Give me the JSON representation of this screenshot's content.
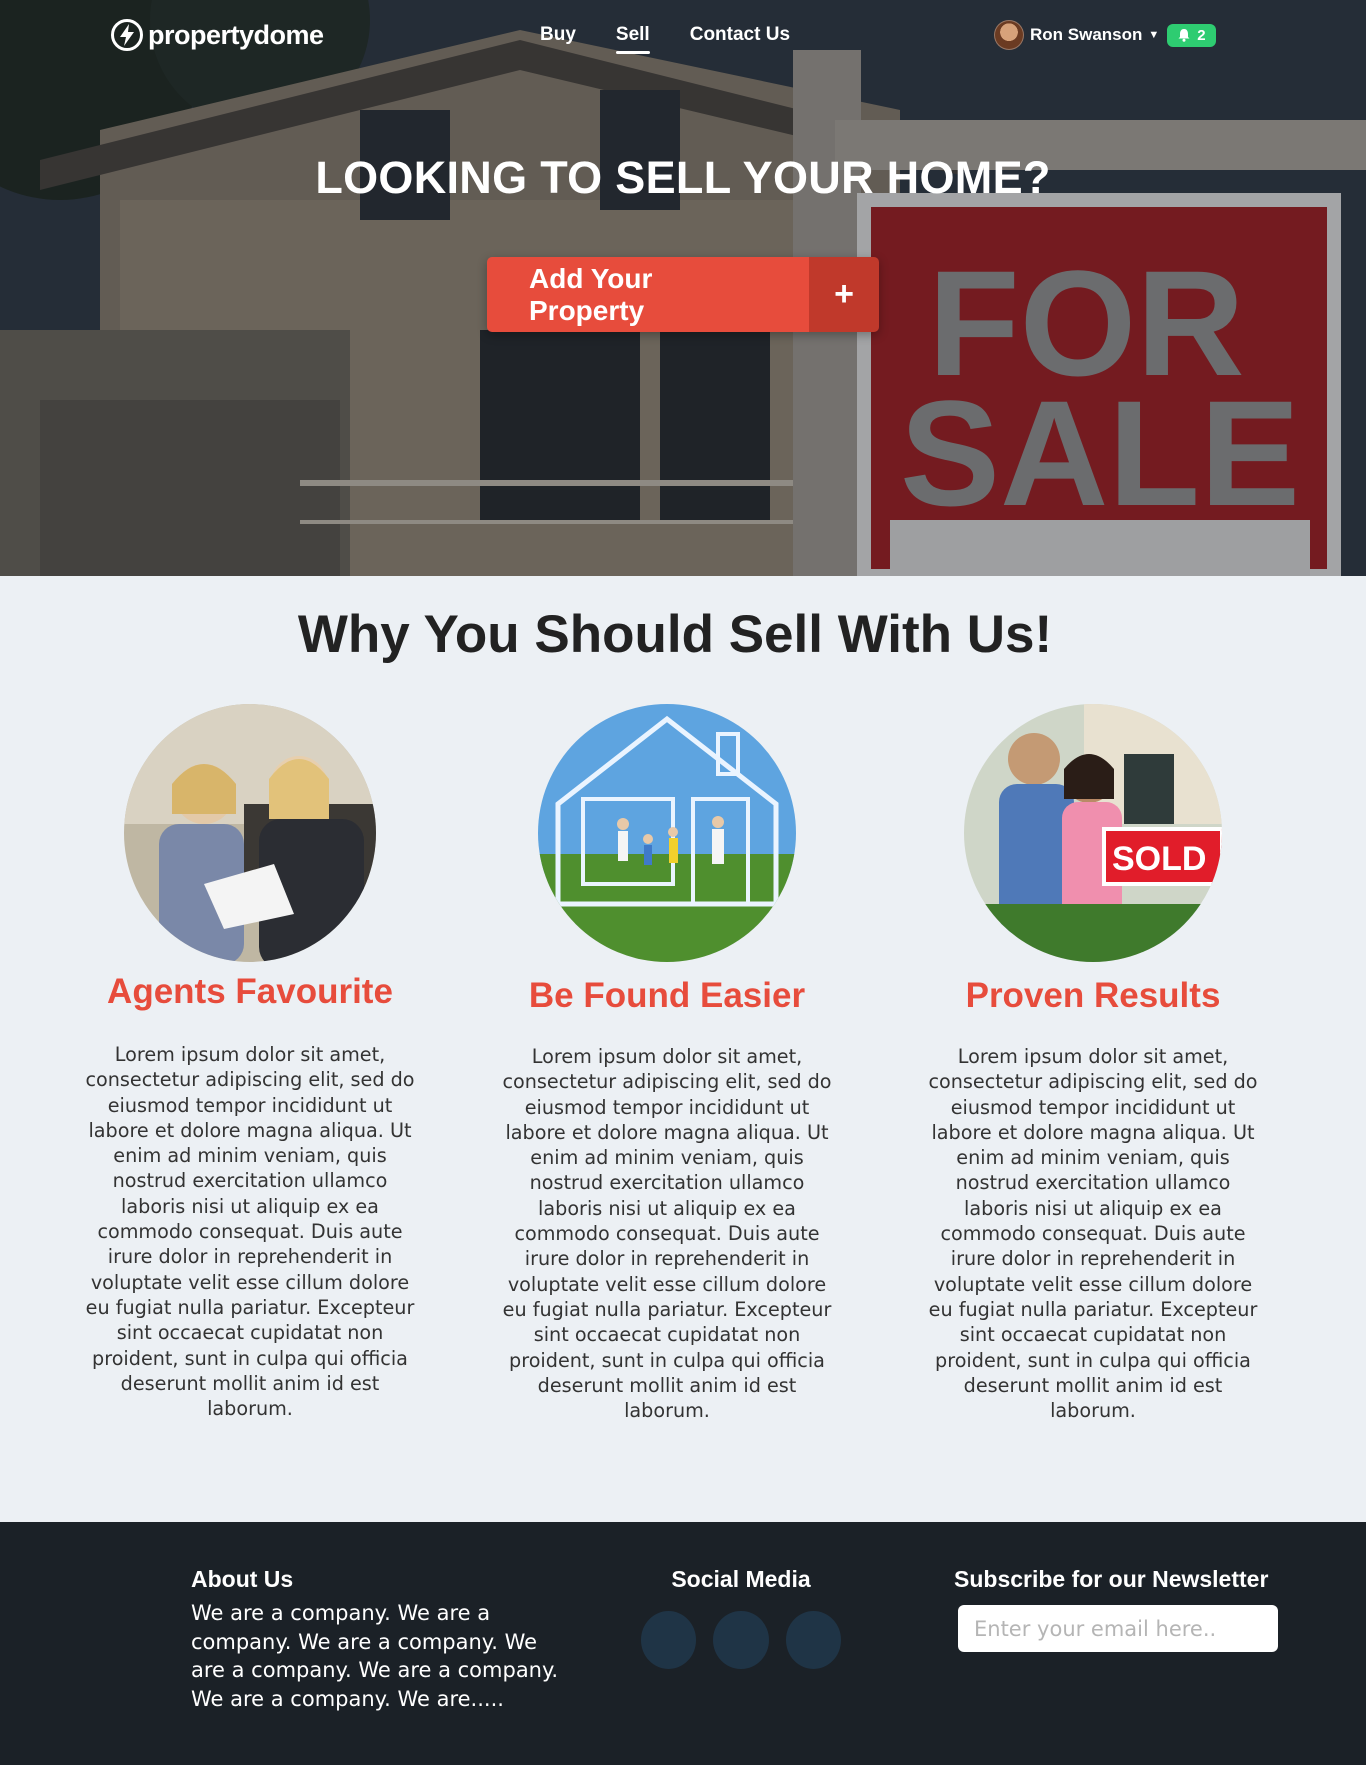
{
  "brand": {
    "name": "propertydome"
  },
  "nav": {
    "items": [
      {
        "label": "Buy"
      },
      {
        "label": "Sell",
        "active": true
      },
      {
        "label": "Contact Us"
      }
    ]
  },
  "user": {
    "name": "Ron Swanson",
    "notifications": "2"
  },
  "hero": {
    "title": "LOOKING TO SELL YOUR HOME?",
    "cta_label": "Add Your Property",
    "cta_icon": "+",
    "sign_line1": "FOR",
    "sign_line2": "SALE"
  },
  "why": {
    "title": "Why You Should Sell With Us!",
    "features": [
      {
        "title": "Agents Favourite",
        "text": "Lorem ipsum dolor sit amet, consectetur adipiscing elit, sed do eiusmod tempor incididunt ut labore et dolore magna aliqua. Ut enim ad minim veniam, quis nostrud exercitation ullamco laboris nisi ut aliquip ex ea commodo consequat. Duis aute irure dolor in reprehenderit in voluptate velit esse cillum dolore eu fugiat nulla pariatur. Excepteur sint occaecat cupidatat non proident, sunt in culpa qui officia deserunt mollit anim id est laborum."
      },
      {
        "title": "Be Found Easier",
        "text": "Lorem ipsum dolor sit amet, consectetur adipiscing elit, sed do eiusmod tempor incididunt ut labore et dolore magna aliqua. Ut enim ad minim veniam, quis nostrud exercitation ullamco laboris nisi ut aliquip ex ea commodo consequat. Duis aute irure dolor in reprehenderit in voluptate velit esse cillum dolore eu fugiat nulla pariatur. Excepteur sint occaecat cupidatat non proident, sunt in culpa qui officia deserunt mollit anim id est laborum."
      },
      {
        "title": "Proven Results",
        "text": "Lorem ipsum dolor sit amet, consectetur adipiscing elit, sed do eiusmod tempor incididunt ut labore et dolore magna aliqua. Ut enim ad minim veniam, quis nostrud exercitation ullamco laboris nisi ut aliquip ex ea commodo consequat. Duis aute irure dolor in reprehenderit in voluptate velit esse cillum dolore eu fugiat nulla pariatur. Excepteur sint occaecat cupidatat non proident, sunt in culpa qui officia deserunt mollit anim id est laborum.",
        "badge": "SOLD"
      }
    ]
  },
  "footer": {
    "about_title": "About Us",
    "about_text": "We are a company. We are a company. We are a company. We are a company. We are a company. We are a company. We are.....",
    "social_title": "Social Media",
    "newsletter_title": "Subscribe for our Newsletter",
    "email_placeholder": "Enter your email here.."
  },
  "colors": {
    "accent": "#e74c3c",
    "accent_dark": "#c0392b",
    "notif": "#2ecc71",
    "footer": "#1b2127",
    "page": "#ecf0f4"
  }
}
